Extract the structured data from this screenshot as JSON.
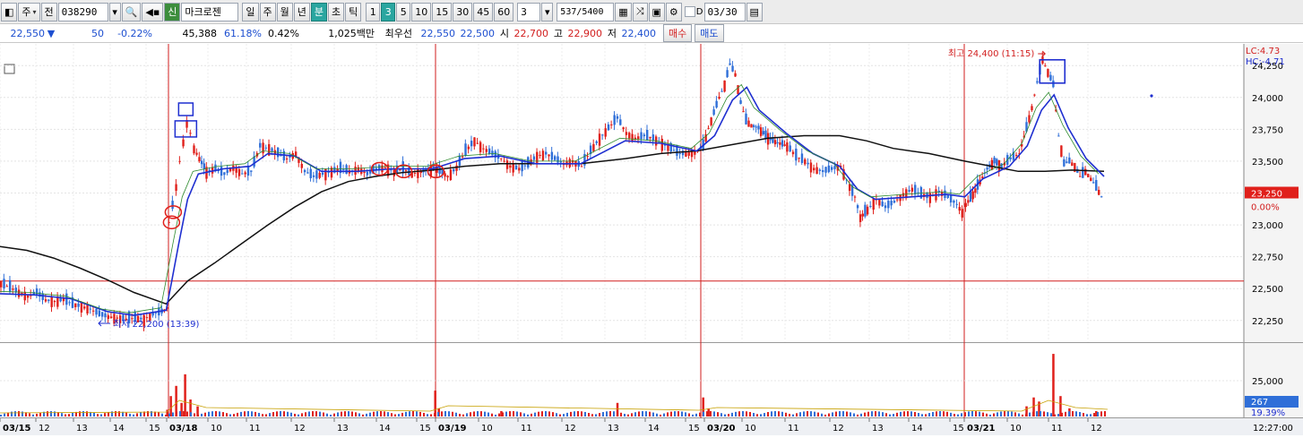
{
  "toolbar": {
    "mode": "주",
    "prefix": "전",
    "code": "038290",
    "name_badge": "신",
    "name": "마크로젠",
    "period_tabs": [
      "일",
      "주",
      "월",
      "년",
      "분",
      "초",
      "틱"
    ],
    "active_period": "분",
    "intervals": [
      "1",
      "3",
      "5",
      "10",
      "15",
      "30",
      "45",
      "60"
    ],
    "active_interval": "3",
    "interval_value": "3",
    "count": "537",
    "count_total": "/5400",
    "d_label": "D",
    "date": "03/30"
  },
  "quote": {
    "price": "22,550",
    "arrow": "▼",
    "change": "50",
    "change_pct": "-0.22%",
    "volume": "45,388",
    "volume_ratio": "61.18%",
    "turnover_pct": "0.42%",
    "amount": "1,025백만",
    "best_label": "최우선",
    "best_ask": "22,550",
    "best_bid": "22,500",
    "open_label": "시",
    "open": "22,700",
    "high_label": "고",
    "high": "22,900",
    "low_label": "저",
    "low": "22,400",
    "buy_label": "매수",
    "sell_label": "매도"
  },
  "chart_data": {
    "type": "candlestick",
    "price_ticks": [
      "24,250",
      "24,000",
      "23,750",
      "23,500",
      "23,250",
      "23,000",
      "22,750",
      "22,500",
      "22,250"
    ],
    "price_values": [
      24250,
      24000,
      23750,
      23500,
      23250,
      23000,
      22750,
      22500,
      22250
    ],
    "ylim": [
      22080,
      24420
    ],
    "volume_ticks": [
      "25,000"
    ],
    "lc_label": "LC:4.73",
    "hc_label": "HC:-4.71",
    "current_price_label": "23,250",
    "current_price": 23250,
    "current_pct_label": "0.00%",
    "reference_price": 22560,
    "high_annotation": "최고 24,400 (11:15)",
    "low_annotation": "최저 22,200 (13:39)",
    "volume_last_label": "267",
    "volume_pct_label": "19.39%",
    "time_label": "12:27:00",
    "day_separators": [
      {
        "date": "03/18"
      },
      {
        "date": "03/19"
      },
      {
        "date": "03/20"
      },
      {
        "date": "03/21"
      }
    ],
    "x_tick_labels": [
      "03/15",
      "12",
      "13",
      "14",
      "15",
      "03/18",
      "10",
      "11",
      "12",
      "13",
      "14",
      "15",
      "03/19",
      "10",
      "11",
      "12",
      "13",
      "14",
      "15",
      "03/20",
      "10",
      "11",
      "12",
      "13",
      "14",
      "15",
      "03/21",
      "10",
      "11",
      "12"
    ],
    "close_path": [
      [
        0,
        22540
      ],
      [
        10,
        22510
      ],
      [
        20,
        22470
      ],
      [
        30,
        22440
      ],
      [
        40,
        22470
      ],
      [
        50,
        22410
      ],
      [
        60,
        22400
      ],
      [
        70,
        22420
      ],
      [
        80,
        22380
      ],
      [
        90,
        22360
      ],
      [
        100,
        22340
      ],
      [
        110,
        22300
      ],
      [
        120,
        22280
      ],
      [
        130,
        22270
      ],
      [
        140,
        22260
      ],
      [
        150,
        22270
      ],
      [
        160,
        22260
      ],
      [
        170,
        22300
      ],
      [
        180,
        22320
      ],
      [
        186,
        22350
      ],
      [
        188,
        23020
      ],
      [
        192,
        23150
      ],
      [
        196,
        23300
      ],
      [
        200,
        23500
      ],
      [
        204,
        23650
      ],
      [
        208,
        23800
      ],
      [
        212,
        23720
      ],
      [
        216,
        23600
      ],
      [
        222,
        23520
      ],
      [
        230,
        23420
      ],
      [
        240,
        23440
      ],
      [
        250,
        23400
      ],
      [
        260,
        23450
      ],
      [
        270,
        23400
      ],
      [
        280,
        23420
      ],
      [
        290,
        23620
      ],
      [
        300,
        23600
      ],
      [
        310,
        23560
      ],
      [
        320,
        23520
      ],
      [
        330,
        23560
      ],
      [
        340,
        23420
      ],
      [
        350,
        23380
      ],
      [
        360,
        23400
      ],
      [
        370,
        23420
      ],
      [
        380,
        23440
      ],
      [
        390,
        23420
      ],
      [
        400,
        23440
      ],
      [
        410,
        23400
      ],
      [
        420,
        23440
      ],
      [
        430,
        23450
      ],
      [
        440,
        23420
      ],
      [
        450,
        23440
      ],
      [
        460,
        23400
      ],
      [
        470,
        23420
      ],
      [
        484,
        23440
      ],
      [
        488,
        23440
      ],
      [
        500,
        23380
      ],
      [
        510,
        23450
      ],
      [
        520,
        23580
      ],
      [
        530,
        23660
      ],
      [
        540,
        23600
      ],
      [
        550,
        23560
      ],
      [
        560,
        23520
      ],
      [
        570,
        23460
      ],
      [
        580,
        23440
      ],
      [
        590,
        23480
      ],
      [
        600,
        23540
      ],
      [
        610,
        23560
      ],
      [
        620,
        23520
      ],
      [
        630,
        23480
      ],
      [
        640,
        23500
      ],
      [
        650,
        23460
      ],
      [
        660,
        23580
      ],
      [
        670,
        23680
      ],
      [
        680,
        23760
      ],
      [
        690,
        23840
      ],
      [
        700,
        23720
      ],
      [
        710,
        23680
      ],
      [
        720,
        23700
      ],
      [
        730,
        23680
      ],
      [
        740,
        23640
      ],
      [
        750,
        23600
      ],
      [
        760,
        23560
      ],
      [
        770,
        23560
      ],
      [
        780,
        23580
      ],
      [
        786,
        23620
      ],
      [
        792,
        23760
      ],
      [
        798,
        23880
      ],
      [
        804,
        24000
      ],
      [
        810,
        24100
      ],
      [
        816,
        24260
      ],
      [
        822,
        24180
      ],
      [
        828,
        23960
      ],
      [
        834,
        23820
      ],
      [
        840,
        23780
      ],
      [
        848,
        23760
      ],
      [
        856,
        23700
      ],
      [
        864,
        23660
      ],
      [
        872,
        23640
      ],
      [
        880,
        23620
      ],
      [
        890,
        23540
      ],
      [
        900,
        23500
      ],
      [
        910,
        23440
      ],
      [
        920,
        23420
      ],
      [
        930,
        23440
      ],
      [
        940,
        23460
      ],
      [
        950,
        23300
      ],
      [
        956,
        23220
      ],
      [
        962,
        23060
      ],
      [
        970,
        23120
      ],
      [
        980,
        23200
      ],
      [
        990,
        23140
      ],
      [
        1000,
        23180
      ],
      [
        1010,
        23240
      ],
      [
        1020,
        23280
      ],
      [
        1030,
        23240
      ],
      [
        1040,
        23220
      ],
      [
        1050,
        23260
      ],
      [
        1060,
        23220
      ],
      [
        1070,
        23160
      ],
      [
        1076,
        23100
      ],
      [
        1080,
        23160
      ],
      [
        1088,
        23240
      ],
      [
        1096,
        23340
      ],
      [
        1104,
        23440
      ],
      [
        1112,
        23500
      ],
      [
        1120,
        23460
      ],
      [
        1130,
        23520
      ],
      [
        1140,
        23560
      ],
      [
        1148,
        23760
      ],
      [
        1154,
        23920
      ],
      [
        1160,
        24120
      ],
      [
        1166,
        24300
      ],
      [
        1172,
        24200
      ],
      [
        1178,
        24100
      ],
      [
        1184,
        23700
      ],
      [
        1190,
        23480
      ],
      [
        1196,
        23500
      ],
      [
        1202,
        23460
      ],
      [
        1208,
        23380
      ],
      [
        1214,
        23420
      ],
      [
        1220,
        23360
      ],
      [
        1226,
        23300
      ],
      [
        1232,
        23220
      ],
      [
        1236,
        23250
      ]
    ],
    "ma_short": [
      [
        0,
        22460
      ],
      [
        40,
        22450
      ],
      [
        80,
        22420
      ],
      [
        120,
        22320
      ],
      [
        150,
        22290
      ],
      [
        186,
        22330
      ],
      [
        192,
        22550
      ],
      [
        200,
        22850
      ],
      [
        210,
        23200
      ],
      [
        222,
        23400
      ],
      [
        250,
        23440
      ],
      [
        280,
        23460
      ],
      [
        300,
        23560
      ],
      [
        330,
        23540
      ],
      [
        360,
        23420
      ],
      [
        400,
        23420
      ],
      [
        440,
        23440
      ],
      [
        484,
        23440
      ],
      [
        520,
        23520
      ],
      [
        560,
        23540
      ],
      [
        600,
        23480
      ],
      [
        650,
        23480
      ],
      [
        700,
        23660
      ],
      [
        740,
        23640
      ],
      [
        780,
        23580
      ],
      [
        800,
        23700
      ],
      [
        820,
        23980
      ],
      [
        836,
        24080
      ],
      [
        850,
        23900
      ],
      [
        880,
        23720
      ],
      [
        910,
        23560
      ],
      [
        940,
        23460
      ],
      [
        960,
        23280
      ],
      [
        980,
        23200
      ],
      [
        1020,
        23220
      ],
      [
        1060,
        23240
      ],
      [
        1080,
        23220
      ],
      [
        1100,
        23360
      ],
      [
        1130,
        23460
      ],
      [
        1150,
        23620
      ],
      [
        1166,
        23900
      ],
      [
        1180,
        24020
      ],
      [
        1196,
        23760
      ],
      [
        1216,
        23520
      ],
      [
        1236,
        23380
      ]
    ],
    "ma_long": [
      [
        0,
        22830
      ],
      [
        30,
        22800
      ],
      [
        60,
        22740
      ],
      [
        90,
        22660
      ],
      [
        120,
        22570
      ],
      [
        150,
        22470
      ],
      [
        186,
        22380
      ],
      [
        210,
        22560
      ],
      [
        240,
        22700
      ],
      [
        270,
        22850
      ],
      [
        300,
        23000
      ],
      [
        330,
        23140
      ],
      [
        360,
        23260
      ],
      [
        390,
        23340
      ],
      [
        420,
        23380
      ],
      [
        450,
        23410
      ],
      [
        484,
        23430
      ],
      [
        520,
        23460
      ],
      [
        560,
        23480
      ],
      [
        600,
        23480
      ],
      [
        650,
        23480
      ],
      [
        700,
        23520
      ],
      [
        740,
        23560
      ],
      [
        780,
        23580
      ],
      [
        820,
        23630
      ],
      [
        860,
        23680
      ],
      [
        900,
        23700
      ],
      [
        940,
        23700
      ],
      [
        970,
        23660
      ],
      [
        1000,
        23600
      ],
      [
        1040,
        23560
      ],
      [
        1080,
        23500
      ],
      [
        1110,
        23460
      ],
      [
        1140,
        23420
      ],
      [
        1170,
        23420
      ],
      [
        1200,
        23430
      ],
      [
        1236,
        23420
      ]
    ],
    "volume": [
      [
        186,
        0.1
      ],
      [
        190,
        0.3
      ],
      [
        196,
        0.45
      ],
      [
        202,
        0.2
      ],
      [
        206,
        0.62
      ],
      [
        212,
        0.25
      ],
      [
        220,
        0.15
      ],
      [
        486,
        0.38
      ],
      [
        490,
        0.12
      ],
      [
        560,
        0.08
      ],
      [
        690,
        0.2
      ],
      [
        786,
        0.28
      ],
      [
        792,
        0.12
      ],
      [
        1148,
        0.15
      ],
      [
        1156,
        0.28
      ],
      [
        1162,
        0.22
      ],
      [
        1178,
        0.92
      ],
      [
        1186,
        0.3
      ],
      [
        1196,
        0.12
      ],
      [
        1226,
        0.08
      ]
    ]
  }
}
